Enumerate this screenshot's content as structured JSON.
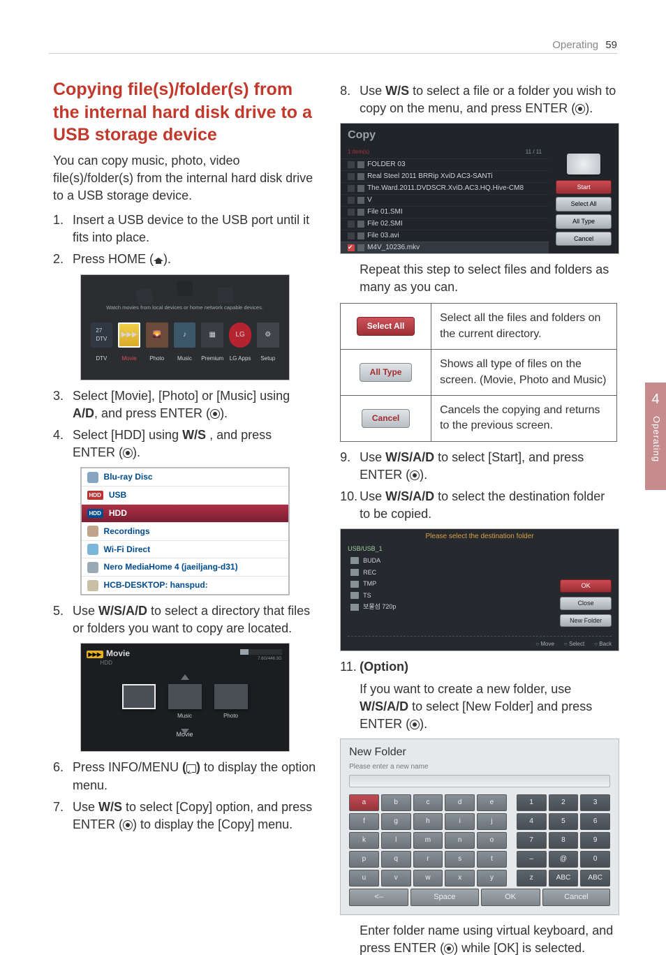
{
  "header": {
    "section": "Operating",
    "page": "59"
  },
  "sidetab": {
    "num": "4",
    "label": "Operating"
  },
  "title": "Copying file(s)/folder(s) from the internal hard disk drive to a USB storage device",
  "intro": "You can copy music, photo, video file(s)/folder(s) from the internal hard disk drive to a USB storage device.",
  "steps": {
    "s1": "Insert a USB device to the USB port until it fits into place.",
    "s2a": "Press HOME (",
    "s2b": ").",
    "s3a": "Select [Movie], [Photo] or [Music] using ",
    "s3b": ", and press ENTER (",
    "s3c": ").",
    "s4a": "Select [HDD] using ",
    "s4b": " , and press ENTER (",
    "s4c": ").",
    "s5a": "Use ",
    "s5b": " to select a directory that files or folders you want to copy are located.",
    "s6a": "Press INFO/MENU ",
    "s6b": " to display the option menu.",
    "s7a": "Use ",
    "s7b": " to select [Copy] option, and press ENTER (",
    "s7c": ") to display the [Copy] menu.",
    "s8a": "Use ",
    "s8b": " to select a file or a folder you wish to copy on the menu, and press ENTER (",
    "s8c": ").",
    "postcopy": "Repeat this step to select files and folders as many as you can.",
    "s9a": "Use ",
    "s9b": " to select [Start], and press ENTER (",
    "s9c": ").",
    "s10a": "Use ",
    "s10b": " to select the destination folder to be copied.",
    "s11t": "(Option)",
    "s11a": "If you want to create a new folder, use ",
    "s11b": " to select [New Folder] and press ENTER (",
    "s11c": ").",
    "s11d": "Enter folder name using virtual keyboard, and press ENTER (",
    "s11e": ") while [OK] is selected."
  },
  "home_menu": {
    "caption": "Watch movies from local devices or home network capable devices.",
    "items": [
      "DTV",
      "Movie",
      "Photo",
      "Music",
      "Premium",
      "LG Apps",
      "Setup"
    ],
    "lg": "LG"
  },
  "devlist": {
    "items": [
      {
        "label": "Blu-ray Disc"
      },
      {
        "label": "USB"
      },
      {
        "label": "HDD",
        "sel": true,
        "hdd": true
      },
      {
        "label": "Recordings"
      },
      {
        "label": "Wi-Fi Direct"
      },
      {
        "label": "Nero MediaHome 4 (jaeiljang-d31)"
      },
      {
        "label": "HCB-DESKTOP: hanspud:"
      }
    ],
    "hdd_badge": "HDD"
  },
  "movie_hdd": {
    "title": "Movie",
    "sub": "HDD",
    "storage": "7.6G/446.3G",
    "thumbs": [
      "Movie",
      "Music",
      "Photo"
    ],
    "cat": "Movie",
    "badge": "▶▶▶"
  },
  "copy_dlg": {
    "title": "Copy",
    "count": "1 item(s)",
    "page": "11 / 11",
    "items": [
      {
        "name": "FOLDER 03",
        "folder": true
      },
      {
        "name": "Real Steel 2011 BRRip XviD AC3-SANTi",
        "folder": true
      },
      {
        "name": "The.Ward.2011.DVDSCR.XviD.AC3.HQ.Hive-CM8",
        "folder": true
      },
      {
        "name": "V",
        "folder": true
      },
      {
        "name": "File 01.SMI"
      },
      {
        "name": "File 02.SMI"
      },
      {
        "name": "File 03.avi"
      },
      {
        "name": "M4V_10236.mkv",
        "checked": true
      }
    ],
    "buttons": {
      "start": "Start",
      "selall": "Select All",
      "alltype": "All Type",
      "cancel": "Cancel"
    }
  },
  "opt_table": {
    "r1": {
      "btn": "Select All",
      "desc": "Select all the files and folders on the current directory."
    },
    "r2": {
      "btn": "All Type",
      "desc": "Shows all type of files on the screen. (Movie, Photo and Music)"
    },
    "r3": {
      "btn": "Cancel",
      "desc": "Cancels the copying and returns to the previous screen."
    }
  },
  "dest_dlg": {
    "header": "Please select the destination folder",
    "path": "USB/USB_1",
    "folders": [
      "BUDA",
      "REC",
      "TMP",
      "TS",
      "보물섬 720p"
    ],
    "buttons": {
      "ok": "OK",
      "close": "Close",
      "newf": "New Folder"
    },
    "footer": [
      "Move",
      "Select",
      "Back"
    ]
  },
  "kbd": {
    "title": "New Folder",
    "sub": "Please enter a new name",
    "rows": [
      [
        "a",
        "b",
        "c",
        "d",
        "e",
        "",
        "1",
        "2",
        "3"
      ],
      [
        "f",
        "g",
        "h",
        "i",
        "j",
        "",
        "4",
        "5",
        "6"
      ],
      [
        "k",
        "l",
        "m",
        "n",
        "o",
        "",
        "7",
        "8",
        "9"
      ],
      [
        "p",
        "q",
        "r",
        "s",
        "t",
        "",
        "–",
        "@",
        "0"
      ],
      [
        "u",
        "v",
        "w",
        "x",
        "y",
        "",
        "z",
        "ABC",
        "ABC"
      ]
    ],
    "bottom": [
      "<–",
      "Space",
      "OK",
      "Cancel"
    ]
  },
  "glyphs": {
    "udlr": "W/S/A/D",
    "ud": "W/S",
    "lr": "A/D"
  }
}
